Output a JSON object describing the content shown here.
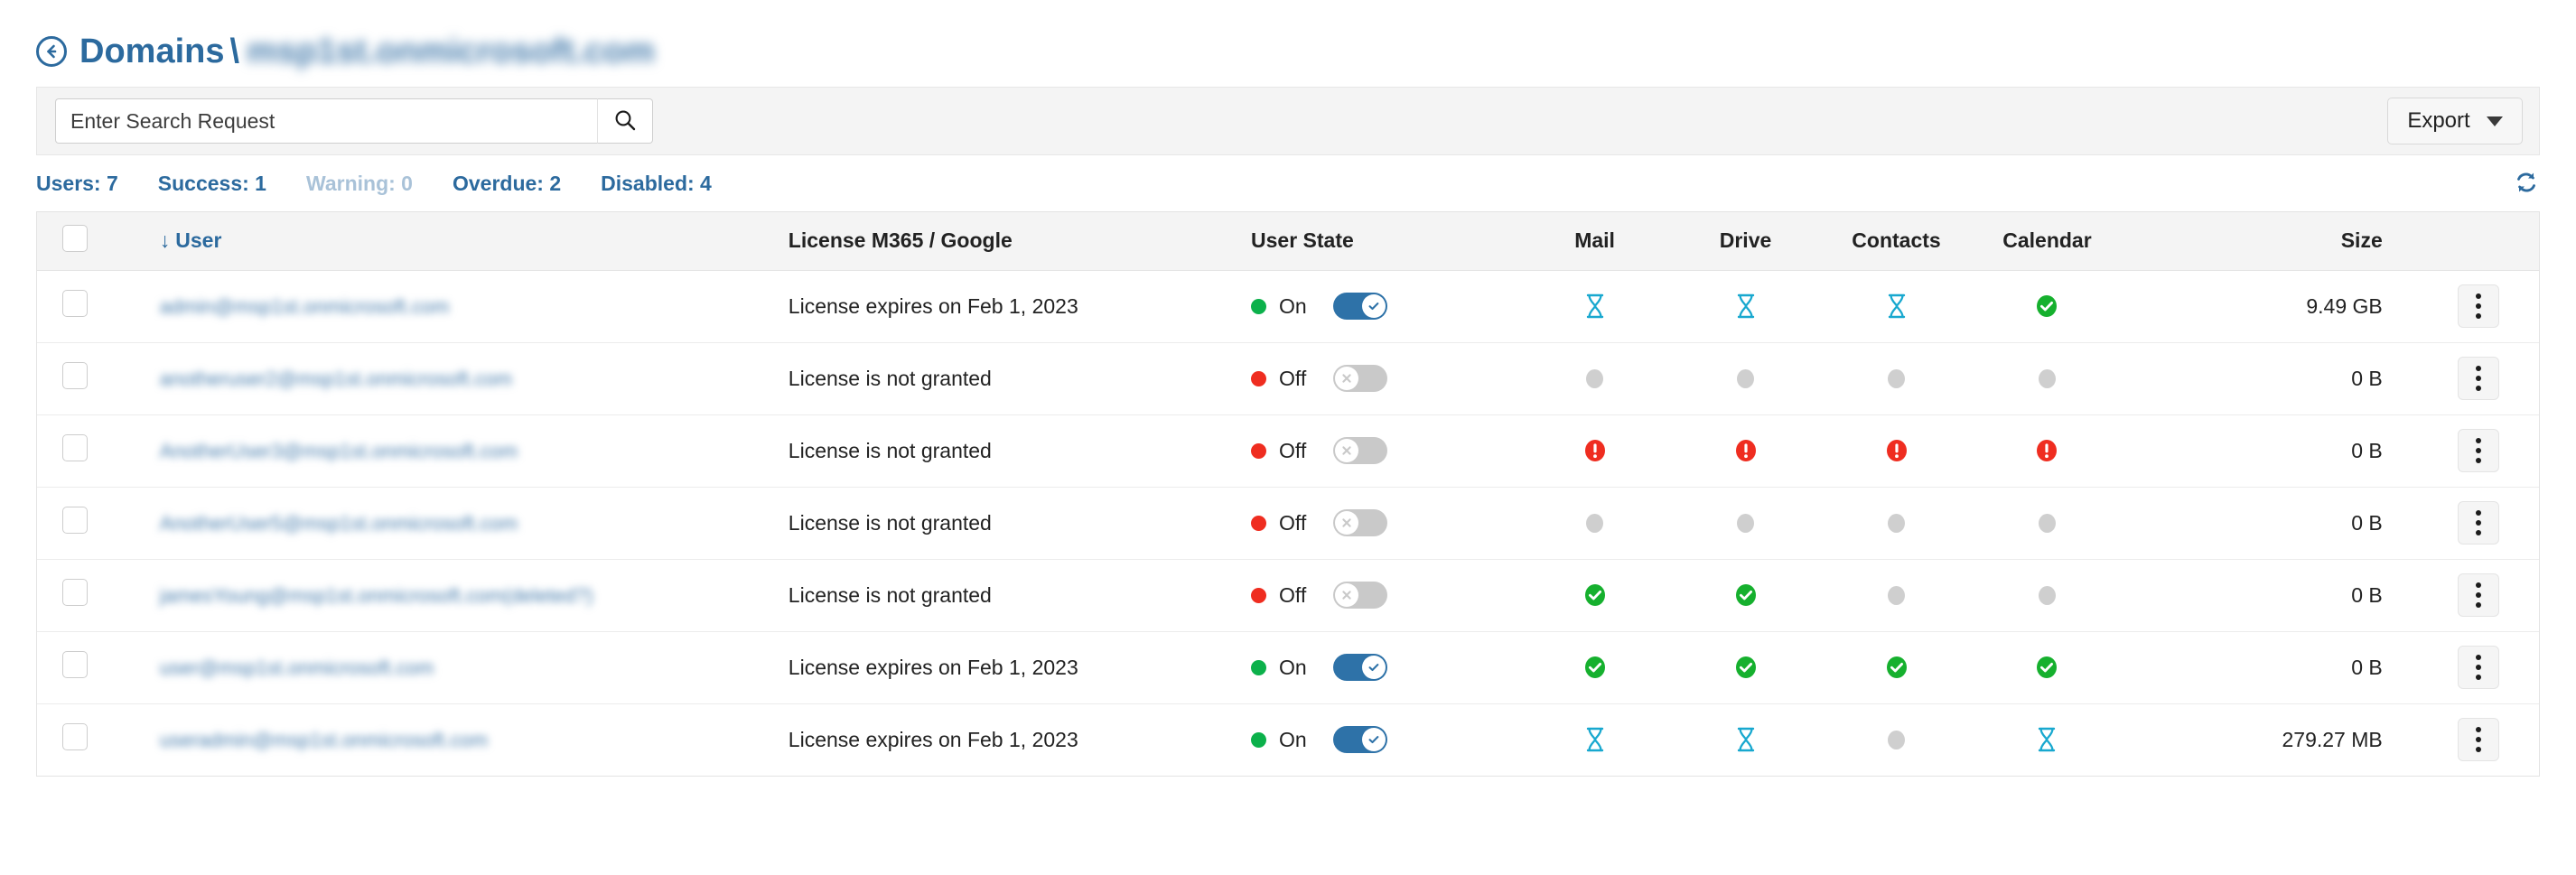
{
  "header": {
    "back_icon": "back-arrow-circle-icon",
    "breadcrumb_root": "Domains",
    "breadcrumb_separator": "\\",
    "breadcrumb_current": "msp1st.onmicrosoft.com"
  },
  "toolbar": {
    "search_placeholder": "Enter Search Request",
    "search_value": "",
    "search_icon": "search-icon",
    "export_label": "Export",
    "export_caret": "chevron-down-icon"
  },
  "stats": [
    {
      "label": "Users: 7",
      "muted": false
    },
    {
      "label": "Success: 1",
      "muted": false
    },
    {
      "label": "Warning: 0",
      "muted": true
    },
    {
      "label": "Overdue: 2",
      "muted": false
    },
    {
      "label": "Disabled: 4",
      "muted": false
    }
  ],
  "refresh_icon": "refresh-icon",
  "table": {
    "columns": {
      "select_all": "",
      "user": "User",
      "sort_arrow": "↓",
      "license": "License M365 / Google",
      "user_state": "User State",
      "mail": "Mail",
      "drive": "Drive",
      "contacts": "Contacts",
      "calendar": "Calendar",
      "size": "Size"
    },
    "rows": [
      {
        "user": "admin@msp1st.onmicrosoft.com",
        "license": "License expires on Feb 1, 2023",
        "state_label": "On",
        "state_on": true,
        "mail": "pending",
        "drive": "pending",
        "contacts": "pending",
        "calendar": "success",
        "size": "9.49 GB"
      },
      {
        "user": "anotheruser2@msp1st.onmicrosoft.com",
        "license": "License is not granted",
        "state_label": "Off",
        "state_on": false,
        "mail": "none",
        "drive": "none",
        "contacts": "none",
        "calendar": "none",
        "size": "0 B"
      },
      {
        "user": "AnotherUser3@msp1st.onmicrosoft.com",
        "license": "License is not granted",
        "state_label": "Off",
        "state_on": false,
        "mail": "error",
        "drive": "error",
        "contacts": "error",
        "calendar": "error",
        "size": "0 B"
      },
      {
        "user": "AnotherUser5@msp1st.onmicrosoft.com",
        "license": "License is not granted",
        "state_label": "Off",
        "state_on": false,
        "mail": "none",
        "drive": "none",
        "contacts": "none",
        "calendar": "none",
        "size": "0 B"
      },
      {
        "user": "jamesYoung@msp1st.onmicrosoft.com(deleted?)",
        "license": "License is not granted",
        "state_label": "Off",
        "state_on": false,
        "mail": "success",
        "drive": "success",
        "contacts": "none",
        "calendar": "none",
        "size": "0 B"
      },
      {
        "user": "user@msp1st.onmicrosoft.com",
        "license": "License expires on Feb 1, 2023",
        "state_label": "On",
        "state_on": true,
        "mail": "success",
        "drive": "success",
        "contacts": "success",
        "calendar": "success",
        "size": "0 B"
      },
      {
        "user": "useradmin@msp1st.onmicrosoft.com",
        "license": "License expires on Feb 1, 2023",
        "state_label": "On",
        "state_on": true,
        "mail": "pending",
        "drive": "pending",
        "contacts": "none",
        "calendar": "pending",
        "size": "279.27 MB"
      }
    ],
    "row_menu_icon": "kebab-menu-icon"
  },
  "colors": {
    "accent_blue": "#2c6a9e",
    "toggle_on": "#2e72a8",
    "status_success": "#16b02e",
    "status_error": "#ef2d20",
    "status_pending": "#18a8cf",
    "status_none": "#cfcfcf",
    "state_on_dot": "#0cb14b",
    "state_off_dot": "#ef2d20"
  }
}
